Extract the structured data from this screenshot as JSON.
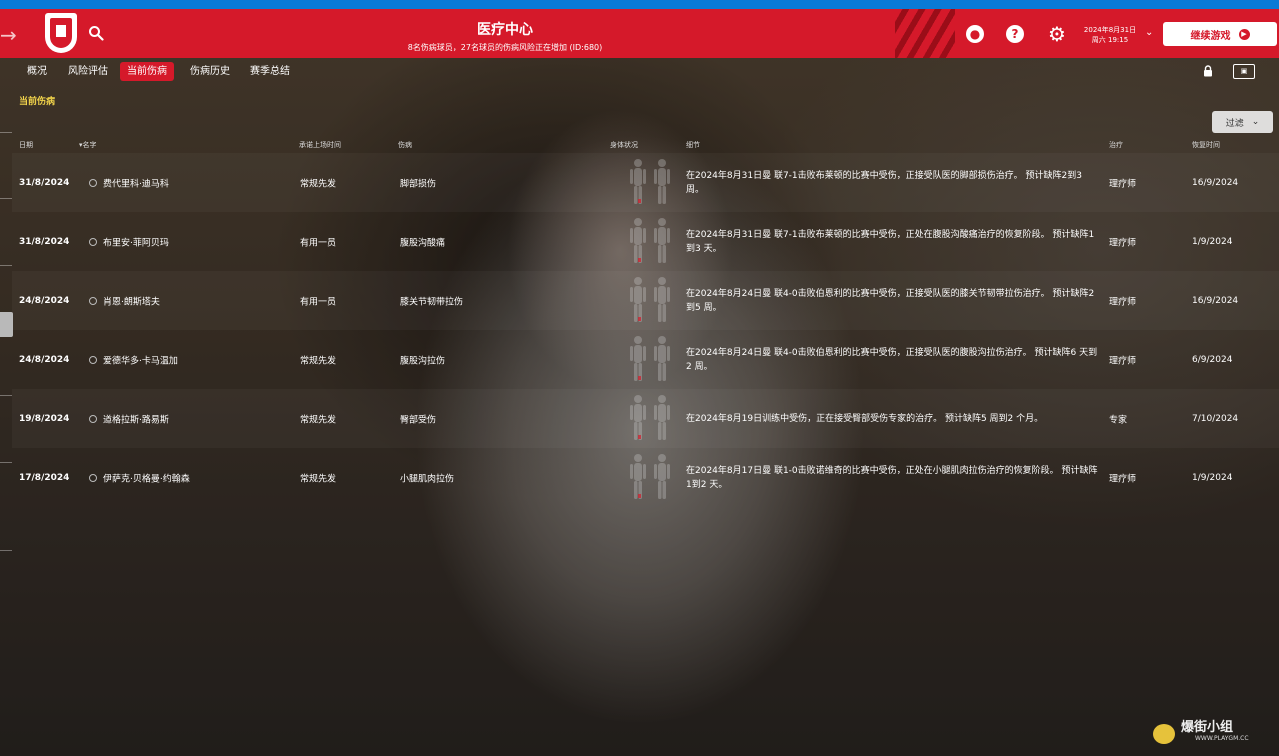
{
  "header": {
    "title": "医疗中心",
    "subtitle": "8名伤病球员，27名球员的伤病风险正在增加 (ID:680)",
    "date": "2024年8月31日",
    "time": "周六 19:15",
    "continue_label": "继续游戏",
    "help_glyph": "?",
    "back_glyph": "→",
    "gear_glyph": "⚙",
    "chevron_glyph": "⌄",
    "accent": "#d5192a"
  },
  "tabs": [
    {
      "label": "概况",
      "active": false
    },
    {
      "label": "风险评估",
      "active": false
    },
    {
      "label": "当前伤病",
      "active": true
    },
    {
      "label": "伤病历史",
      "active": false
    },
    {
      "label": "赛季总结",
      "active": false
    }
  ],
  "section_title": "当前伤病",
  "filter_label": "过滤",
  "columns": {
    "date": "日期",
    "name": "名字",
    "priority": "承诺上场时间",
    "injury": "伤病",
    "body": "身体状况",
    "detail": "细节",
    "treatment": "治疗",
    "return": "恢复时间"
  },
  "rows": [
    {
      "date": "31/8/2024",
      "name": "费代里科·迪马科",
      "priority": "常规先发",
      "injury": "脚部损伤",
      "detail": "在2024年8月31日曼 联7-1击败布莱顿的比赛中受伤，正接受队医的脚部损伤治疗。 预计缺阵2到3 周。",
      "treatment": "理疗师",
      "return": "16/9/2024"
    },
    {
      "date": "31/8/2024",
      "name": "布里安·菲阿贝玛",
      "priority": "有用一员",
      "injury": "腹股沟酸痛",
      "detail": "在2024年8月31日曼 联7-1击败布莱顿的比赛中受伤，正处在腹股沟酸痛治疗的恢复阶段。 预计缺阵1到3 天。",
      "treatment": "理疗师",
      "return": "1/9/2024"
    },
    {
      "date": "24/8/2024",
      "name": "肖恩·朗斯塔夫",
      "priority": "有用一员",
      "injury": "膝关节韧带拉伤",
      "detail": "在2024年8月24日曼 联4-0击败伯恩利的比赛中受伤，正接受队医的膝关节韧带拉伤治疗。 预计缺阵2到5 周。",
      "treatment": "理疗师",
      "return": "16/9/2024"
    },
    {
      "date": "24/8/2024",
      "name": "爱德华多·卡马温加",
      "priority": "常规先发",
      "injury": "腹股沟拉伤",
      "detail": "在2024年8月24日曼 联4-0击败伯恩利的比赛中受伤，正接受队医的腹股沟拉伤治疗。 预计缺阵6 天到2 周。",
      "treatment": "理疗师",
      "return": "6/9/2024"
    },
    {
      "date": "19/8/2024",
      "name": "道格拉斯·路易斯",
      "priority": "常规先发",
      "injury": "臀部受伤",
      "detail": "在2024年8月19日训练中受伤，正在接受臀部受伤专家的治疗。 预计缺阵5 周到2 个月。",
      "treatment": "专家",
      "return": "7/10/2024"
    },
    {
      "date": "17/8/2024",
      "name": "伊萨克·贝格曼·约翰森",
      "priority": "常规先发",
      "injury": "小腿肌肉拉伤",
      "detail": "在2024年8月17日曼 联1-0击败诺维奇的比赛中受伤，正处在小腿肌肉拉伤治疗的恢复阶段。 预计缺阵1到2 天。",
      "treatment": "理疗师",
      "return": "1/9/2024"
    }
  ],
  "watermark": {
    "text": "爆街小组",
    "url_text": "WWW.PLAYGM.CC"
  }
}
